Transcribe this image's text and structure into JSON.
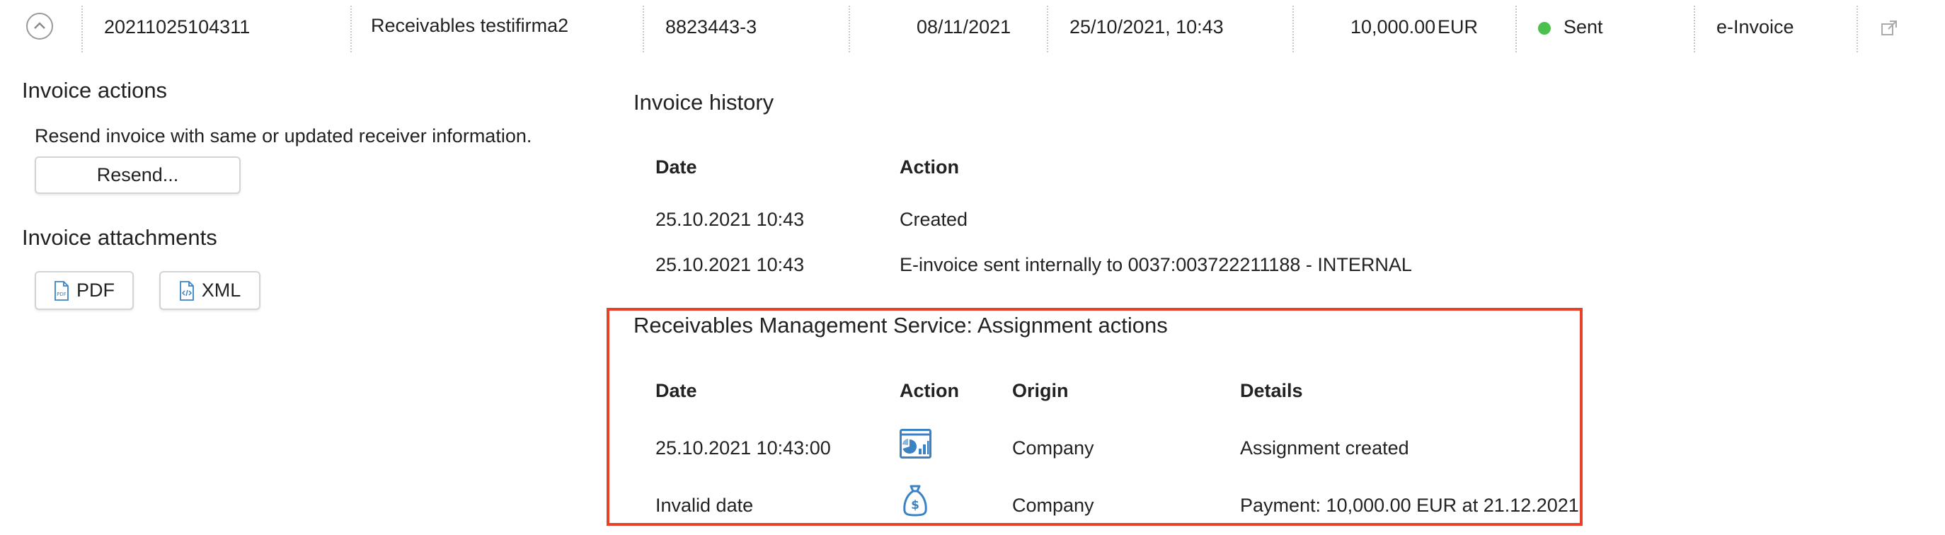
{
  "summary_row": {
    "invoice_number": "20211025104311",
    "customer": "Receivables testifirma2",
    "reference": "8823443-3",
    "due_date": "08/11/2021",
    "created": "25/10/2021, 10:43",
    "amount": "10,000.00",
    "currency": "EUR",
    "status": "Sent",
    "status_color": "#4cc04c",
    "type": "e-Invoice",
    "open_icon": "external-link-icon",
    "collapse_icon": "chevron-up-icon"
  },
  "invoice_actions": {
    "title": "Invoice actions",
    "description": "Resend invoice with same or updated receiver information.",
    "resend_label": "Resend..."
  },
  "invoice_attachments": {
    "title": "Invoice attachments",
    "pdf_label": "PDF",
    "xml_label": "XML",
    "pdf_icon": "pdf-file-icon",
    "xml_icon": "xml-file-icon"
  },
  "invoice_history": {
    "title": "Invoice history",
    "headers": {
      "date": "Date",
      "action": "Action"
    },
    "rows": [
      {
        "date": "25.10.2021 10:43",
        "action": "Created"
      },
      {
        "date": "25.10.2021 10:43",
        "action": "E-invoice sent internally to 0037:003722211188 - INTERNAL"
      }
    ]
  },
  "assignment_actions": {
    "title": "Receivables Management Service: Assignment actions",
    "highlight_color": "#e8402a",
    "headers": {
      "date": "Date",
      "action": "Action",
      "origin": "Origin",
      "details": "Details"
    },
    "rows": [
      {
        "date": "25.10.2021 10:43:00",
        "action_icon": "report-chart-icon",
        "origin": "Company",
        "details": "Assignment created"
      },
      {
        "date": "Invalid date",
        "action_icon": "money-bag-icon",
        "origin": "Company",
        "details": "Payment: 10,000.00 EUR at 21.12.2021"
      }
    ]
  }
}
